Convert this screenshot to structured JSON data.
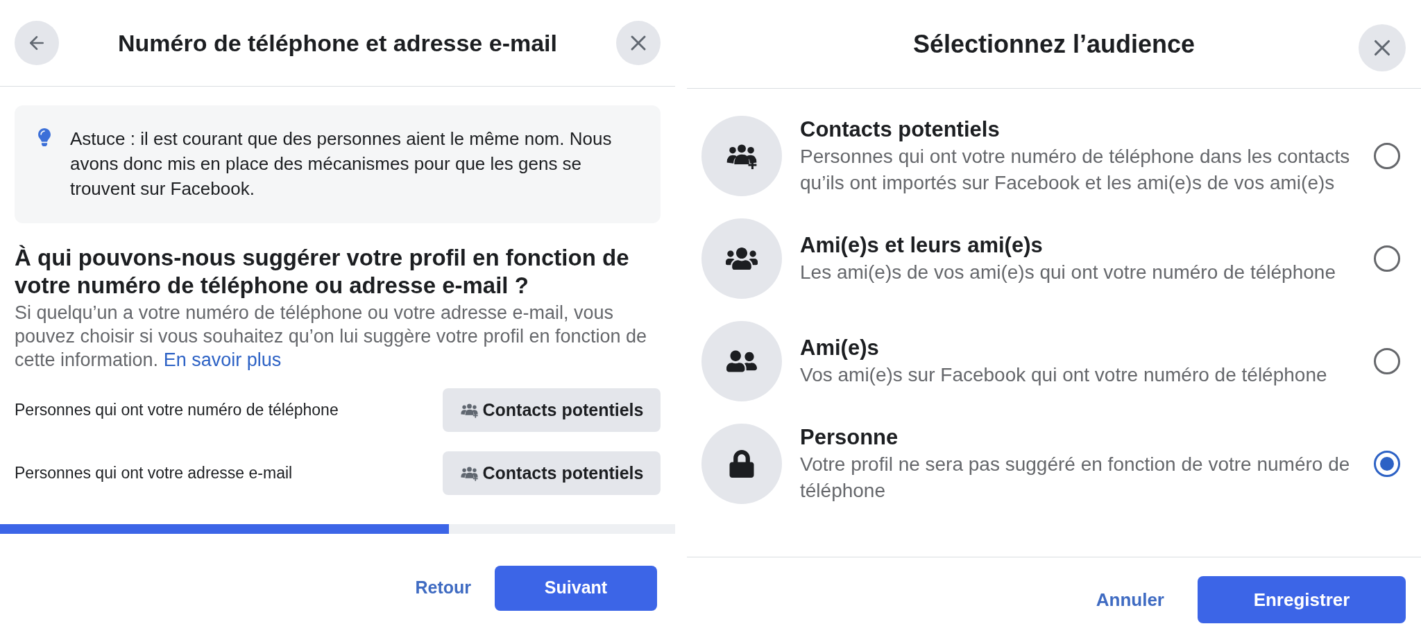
{
  "left_dialog": {
    "title": "Numéro de téléphone et adresse e-mail",
    "tip": "Astuce : il est courant que des personnes aient le même nom. Nous avons donc mis en place des mécanismes pour que les gens se trouvent sur Facebook.",
    "heading": "À qui pouvons-nous suggérer votre profil en fonction de votre numéro de téléphone ou adresse e-mail ?",
    "description": "Si quelqu’un a votre numéro de téléphone ou votre adresse e-mail, vous pouvez choisir si vous souhaitez qu’on lui suggère votre profil en fonction de cette information.",
    "link": "En savoir plus",
    "settings": [
      {
        "label": "Personnes qui ont votre numéro de téléphone",
        "value": "Contacts potentiels"
      },
      {
        "label": "Personnes qui ont votre adresse e-mail",
        "value": "Contacts potentiels"
      }
    ],
    "progress": {
      "level": 0.665
    },
    "buttons": {
      "back": "Retour",
      "next": "Suivant"
    }
  },
  "right_dialog": {
    "title": "Sélectionnez l’audience",
    "options": [
      {
        "kind": "contacts",
        "title": "Contacts potentiels",
        "description": "Personnes qui ont votre numéro de téléphone dans les contacts qu’ils ont importés sur Facebook et les ami(e)s de vos ami(e)s",
        "selected": false
      },
      {
        "kind": "friends_of_friends",
        "title": "Ami(e)s et leurs ami(e)s",
        "description": "Les ami(e)s de vos ami(e)s qui ont votre numéro de téléphone",
        "selected": false
      },
      {
        "kind": "friends",
        "title": "Ami(e)s",
        "description": "Vos ami(e)s sur Facebook qui ont votre numéro de téléphone",
        "selected": false
      },
      {
        "kind": "nobody",
        "title": "Personne",
        "description": "Votre profil ne sera pas suggéré en fonction de votre numéro de téléphone",
        "selected": true
      }
    ],
    "buttons": {
      "cancel": "Annuler",
      "save": "Enregistrer"
    }
  }
}
